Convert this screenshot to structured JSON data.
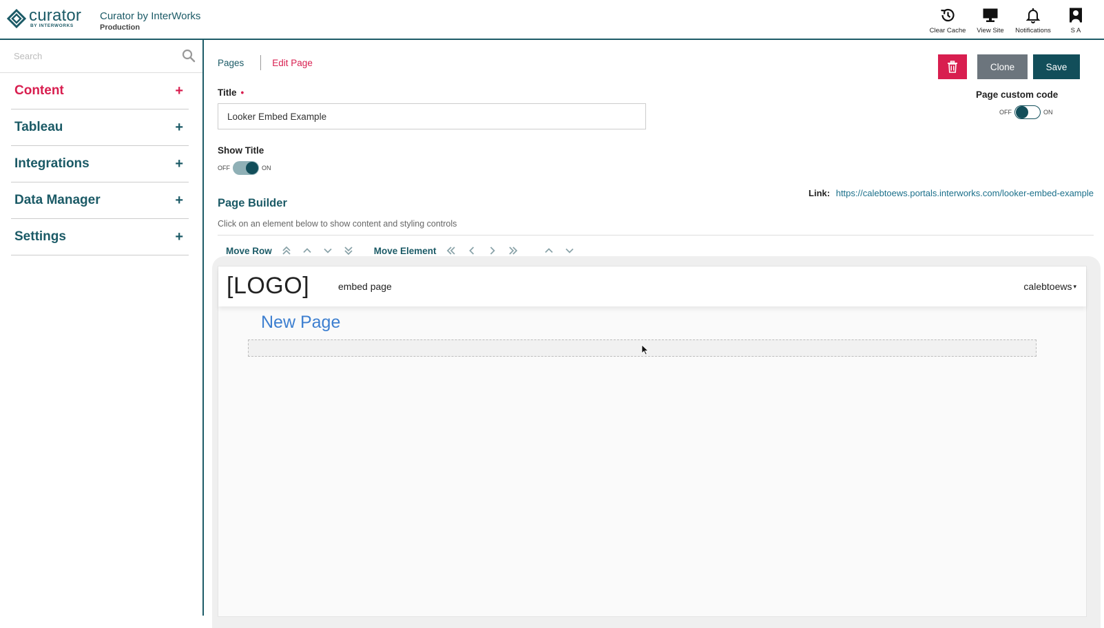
{
  "header": {
    "brand_name": "curator",
    "brand_sub": "BY INTERWORKS",
    "site_title": "Curator by InterWorks",
    "site_env": "Production",
    "actions": [
      {
        "label": "Clear Cache",
        "icon": "history-icon"
      },
      {
        "label": "View Site",
        "icon": "monitor-icon"
      },
      {
        "label": "Notifications",
        "icon": "bell-icon"
      },
      {
        "label": "S A",
        "icon": "user-icon"
      }
    ]
  },
  "sidebar": {
    "search_placeholder": "Search",
    "items": [
      {
        "label": "Content",
        "plus": "+",
        "active": true
      },
      {
        "label": "Tableau",
        "plus": "+"
      },
      {
        "label": "Integrations",
        "plus": "+"
      },
      {
        "label": "Data Manager",
        "plus": "+"
      },
      {
        "label": "Settings",
        "plus": "+"
      }
    ]
  },
  "breadcrumb": {
    "pages": "Pages",
    "current": "Edit Page"
  },
  "toolbar": {
    "clone_label": "Clone",
    "save_label": "Save"
  },
  "form": {
    "title_label": "Title",
    "title_required": "•",
    "title_value": "Looker Embed Example",
    "show_title_label": "Show Title",
    "show_title_state": "on",
    "custom_code_label": "Page custom code",
    "custom_code_state": "off",
    "off_text": "OFF",
    "on_text": "ON"
  },
  "link": {
    "label": "Link:",
    "url": "https://calebtoews.portals.interworks.com/looker-embed-example"
  },
  "page_builder": {
    "title": "Page Builder",
    "subtitle": "Click on an element below to show content and styling controls",
    "move_row_label": "Move Row",
    "move_element_label": "Move Element"
  },
  "preview": {
    "logo": "[LOGO]",
    "nav_link": "embed page",
    "user": "calebtoews",
    "user_caret": "▾",
    "page_heading": "New Page"
  },
  "colors": {
    "brand": "#1b5a66",
    "accent": "#d81e4f",
    "save": "#124e5a",
    "clone": "#6c757d",
    "link": "#1a6f8a"
  }
}
